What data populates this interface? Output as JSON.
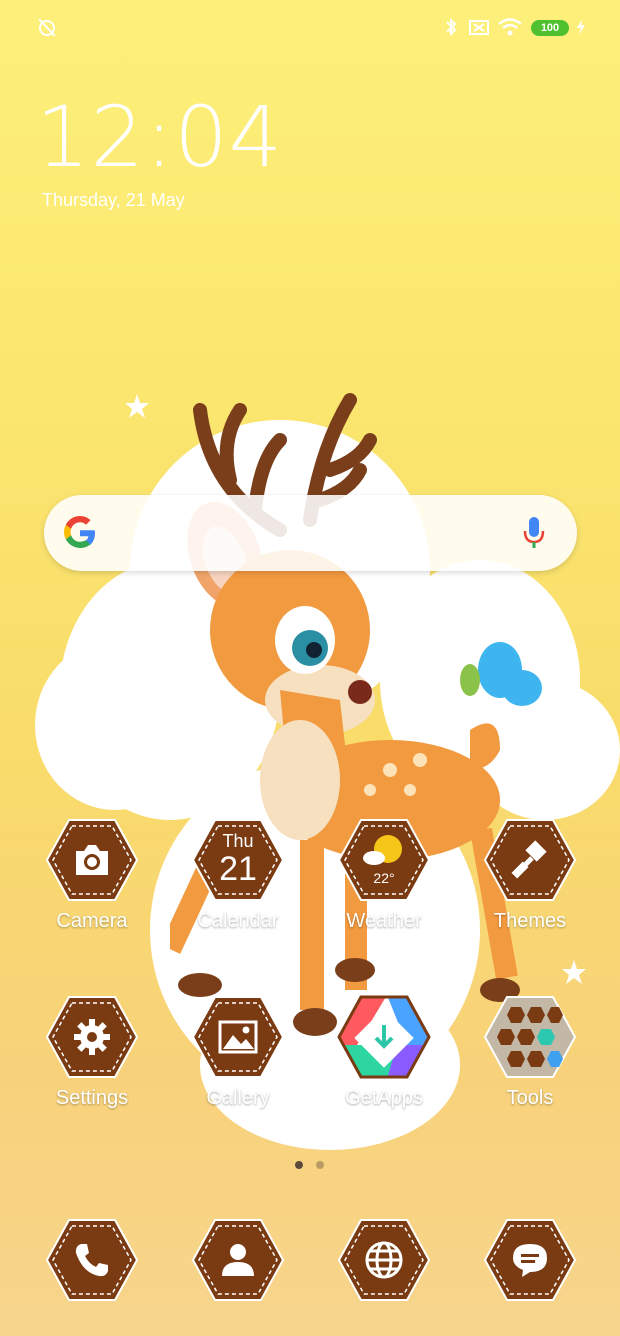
{
  "status_bar": {
    "battery": "100",
    "icons": [
      "alarm-off-icon",
      "bluetooth-icon",
      "sim-off-icon",
      "wifi-icon",
      "charging-icon"
    ]
  },
  "clock": {
    "time": "12:04",
    "date": "Thursday, 21 May"
  },
  "search": {
    "engine": "google-logo",
    "mic": "mic-icon"
  },
  "apps_row1": [
    {
      "label": "Camera",
      "icon": "camera-icon"
    },
    {
      "label": "Calendar",
      "icon": "calendar-icon",
      "day": "Thu",
      "date": "21"
    },
    {
      "label": "Weather",
      "icon": "weather-icon",
      "temp": "22°"
    },
    {
      "label": "Themes",
      "icon": "brush-icon"
    }
  ],
  "apps_row2": [
    {
      "label": "Settings",
      "icon": "gear-icon"
    },
    {
      "label": "Gallery",
      "icon": "image-icon"
    },
    {
      "label": "GetApps",
      "icon": "getapps-icon"
    },
    {
      "label": "Tools",
      "icon": "tools-folder-icon"
    }
  ],
  "dock": [
    {
      "icon": "phone-icon"
    },
    {
      "icon": "contacts-icon"
    },
    {
      "icon": "browser-globe-icon"
    },
    {
      "icon": "messages-icon"
    }
  ],
  "page_indicator": {
    "pages": 2,
    "current": 1
  },
  "colors": {
    "hex_brown": "#7a3a12",
    "hex_border": "#fff",
    "battery_green": "#4fc12f"
  }
}
